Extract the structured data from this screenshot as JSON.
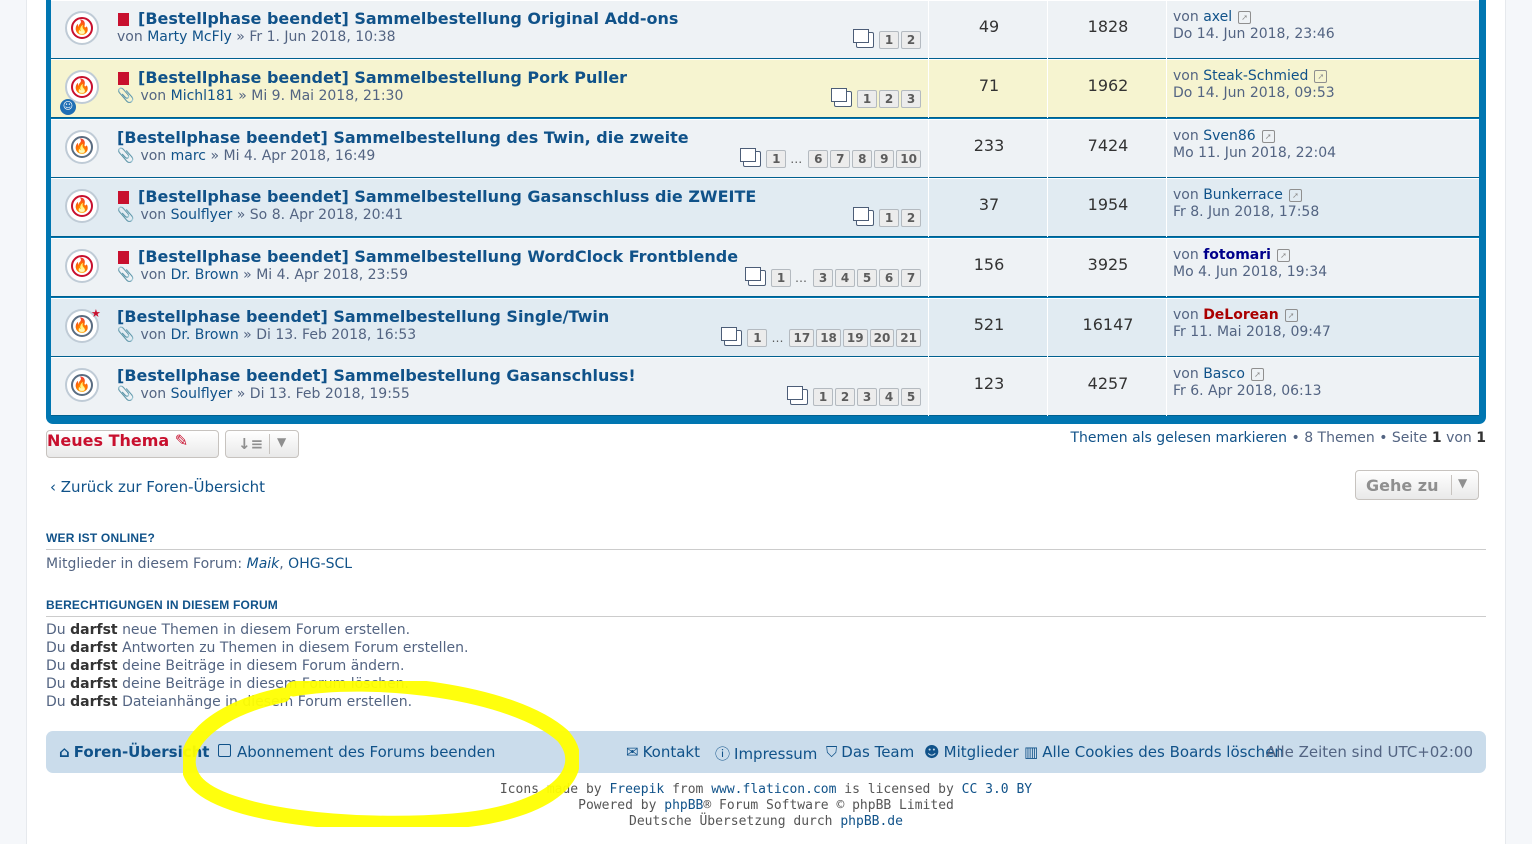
{
  "topics": [
    {
      "title": "[Bestellphase beendet] Sammelbestellung Original Add-ons",
      "author": "Marty McFly",
      "date": "Fr 1. Jun 2018, 10:38",
      "pages": [
        "1",
        "2"
      ],
      "replies": "49",
      "views": "1828",
      "last_user": "axel",
      "last_date": "Do 14. Jun 2018, 23:46",
      "icon": "hot"
    },
    {
      "title": "[Bestellphase beendet] Sammelbestellung Pork Puller",
      "author": "Michl181",
      "date": "Mi 9. Mai 2018, 21:30",
      "pages": [
        "1",
        "2",
        "3"
      ],
      "replies": "71",
      "views": "1962",
      "last_user": "Steak-Schmied",
      "last_date": "Do 14. Jun 2018, 09:53",
      "icon": "hot"
    },
    {
      "title": "[Bestellphase beendet] Sammelbestellung des Twin, die zweite",
      "author": "marc",
      "date": "Mi 4. Apr 2018, 16:49",
      "pages": [
        "1",
        "…",
        "6",
        "7",
        "8",
        "9",
        "10"
      ],
      "replies": "233",
      "views": "7424",
      "last_user": "Sven86",
      "last_date": "Mo 11. Jun 2018, 22:04",
      "icon": "cold"
    },
    {
      "title": "[Bestellphase beendet] Sammelbestellung Gasanschluss die ZWEITE",
      "author": "Soulflyer",
      "date": "So 8. Apr 2018, 20:41",
      "pages": [
        "1",
        "2"
      ],
      "replies": "37",
      "views": "1954",
      "last_user": "Bunkerrace",
      "last_date": "Fr 8. Jun 2018, 17:58",
      "icon": "hot"
    },
    {
      "title": "[Bestellphase beendet] Sammelbestellung WordClock Frontblende",
      "author": "Dr. Brown",
      "date": "Mi 4. Apr 2018, 23:59",
      "pages": [
        "1",
        "…",
        "3",
        "4",
        "5",
        "6",
        "7"
      ],
      "replies": "156",
      "views": "3925",
      "last_user": "fotomari",
      "last_date": "Mo 4. Jun 2018, 19:34",
      "icon": "hot"
    },
    {
      "title": "[Bestellphase beendet] Sammelbestellung Single/Twin",
      "author": "Dr. Brown",
      "date": "Di 13. Feb 2018, 16:53",
      "pages": [
        "1",
        "…",
        "17",
        "18",
        "19",
        "20",
        "21"
      ],
      "replies": "521",
      "views": "16147",
      "last_user": "DeLorean",
      "last_date": "Fr 11. Mai 2018, 09:47",
      "icon": "cold"
    },
    {
      "title": "[Bestellphase beendet] Sammelbestellung Gasanschluss!",
      "author": "Soulflyer",
      "date": "Di 13. Feb 2018, 19:55",
      "pages": [
        "1",
        "2",
        "3",
        "4",
        "5"
      ],
      "replies": "123",
      "views": "4257",
      "last_user": "Basco",
      "last_date": "Fr 6. Apr 2018, 06:13",
      "icon": "cold"
    }
  ],
  "labels": {
    "by": "von",
    "sep": "»"
  },
  "actions": {
    "new_topic": "Neues Thema",
    "mark_read": "Themen als gelesen markieren",
    "topic_count": "8 Themen",
    "page_word": "Seite",
    "page_current": "1",
    "page_of": "von",
    "page_total": "1",
    "back": "Zurück zur Foren-Übersicht",
    "jump": "Gehe zu"
  },
  "online": {
    "heading": "WER IST ONLINE?",
    "prefix": "Mitglieder in diesem Forum:",
    "user1": "Maik",
    "comma": ",",
    "user2": "OHG-SCL"
  },
  "permissions": {
    "heading": "BERECHTIGUNGEN IN DIESEM FORUM",
    "lines": [
      {
        "a": "Du",
        "b": "darfst",
        "c": "neue Themen in diesem Forum erstellen."
      },
      {
        "a": "Du",
        "b": "darfst",
        "c": "Antworten zu Themen in diesem Forum erstellen."
      },
      {
        "a": "Du",
        "b": "darfst",
        "c": "deine Beiträge in diesem Forum ändern."
      },
      {
        "a": "Du",
        "b": "darfst",
        "c": "deine Beiträge in diesem Forum löschen."
      },
      {
        "a": "Du",
        "b": "darfst",
        "c": "Dateianhänge in diesem Forum erstellen."
      }
    ]
  },
  "navbar": {
    "home": "Foren-Übersicht",
    "unsubscribe": "Abonnement des Forums beenden",
    "contact": "Kontakt",
    "imprint": "Impressum",
    "team": "Das Team",
    "members": "Mitglieder",
    "cookies": "Alle Cookies des Boards löschen",
    "timezone": "Alle Zeiten sind UTC+02:00"
  },
  "footer": {
    "icons_made_by": "Icons made by",
    "freepik": "Freepik",
    "from": "from",
    "flaticon": "www.flaticon.com",
    "licensed": "is licensed by",
    "cc": "CC 3.0 BY",
    "powered": "Powered by",
    "phpbb": "phpBB",
    "software": "® Forum Software © phpBB Limited",
    "translation": "Deutsche Übersetzung durch",
    "phpbbde": "phpBB.de"
  },
  "colors": {
    "brand_blue": "#0076b1",
    "link": "#105289",
    "new_topic": "#c8102e",
    "highlight": "#ffff00"
  }
}
